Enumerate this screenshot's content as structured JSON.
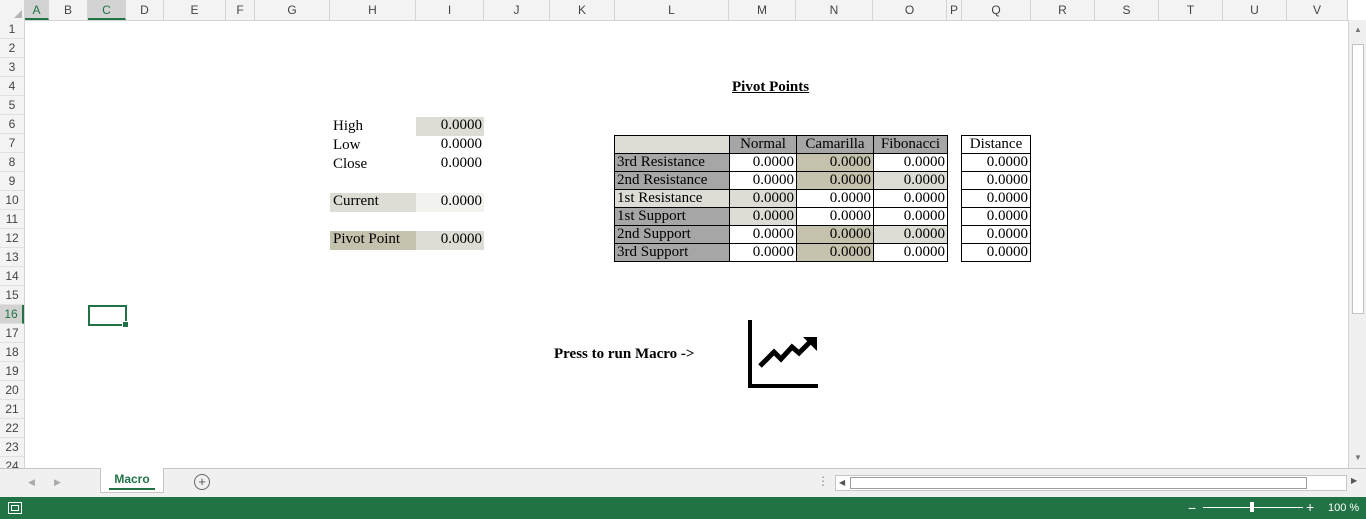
{
  "columns": [
    "A",
    "B",
    "C",
    "D",
    "E",
    "F",
    "G",
    "H",
    "I",
    "J",
    "K",
    "L",
    "M",
    "N",
    "O",
    "P",
    "Q",
    "R",
    "S",
    "T",
    "U",
    "V"
  ],
  "rows": [
    "1",
    "2",
    "3",
    "4",
    "5",
    "6",
    "7",
    "8",
    "9",
    "10",
    "11",
    "12",
    "13",
    "14",
    "15",
    "16",
    "17",
    "18",
    "19",
    "20",
    "21",
    "22",
    "23",
    "24"
  ],
  "selected_column": "C",
  "selected_row": "16",
  "title": "Pivot Points",
  "inputs": {
    "high_label": "High",
    "high_value": "0.0000",
    "low_label": "Low",
    "low_value": "0.0000",
    "close_label": "Close",
    "close_value": "0.0000",
    "current_label": "Current",
    "current_value": "0.0000",
    "pivot_label": "Pivot Point",
    "pivot_value": "0.0000"
  },
  "table": {
    "headers": [
      "Normal",
      "Camarilla",
      "Fibonacci"
    ],
    "distance_header": "Distance",
    "rows": [
      {
        "label": "3rd Resistance",
        "normal": "0.0000",
        "camarilla": "0.0000",
        "fibonacci": "0.0000",
        "distance": "0.0000"
      },
      {
        "label": "2nd Resistance",
        "normal": "0.0000",
        "camarilla": "0.0000",
        "fibonacci": "0.0000",
        "distance": "0.0000"
      },
      {
        "label": "1st Resistance",
        "normal": "0.0000",
        "camarilla": "0.0000",
        "fibonacci": "0.0000",
        "distance": "0.0000"
      },
      {
        "label": "1st Support",
        "normal": "0.0000",
        "camarilla": "0.0000",
        "fibonacci": "0.0000",
        "distance": "0.0000"
      },
      {
        "label": "2nd Support",
        "normal": "0.0000",
        "camarilla": "0.0000",
        "fibonacci": "0.0000",
        "distance": "0.0000"
      },
      {
        "label": "3rd Support",
        "normal": "0.0000",
        "camarilla": "0.0000",
        "fibonacci": "0.0000",
        "distance": "0.0000"
      }
    ]
  },
  "macro_prompt": "Press to run Macro ->",
  "macro_icon": "line-chart-icon",
  "sheet_tab": "Macro",
  "zoom": "100 %",
  "colors": {
    "accent": "#217346",
    "label_shade": "#a6a6a6",
    "light_shade": "#ddddd6",
    "gold_shade": "#c4c1ad"
  }
}
